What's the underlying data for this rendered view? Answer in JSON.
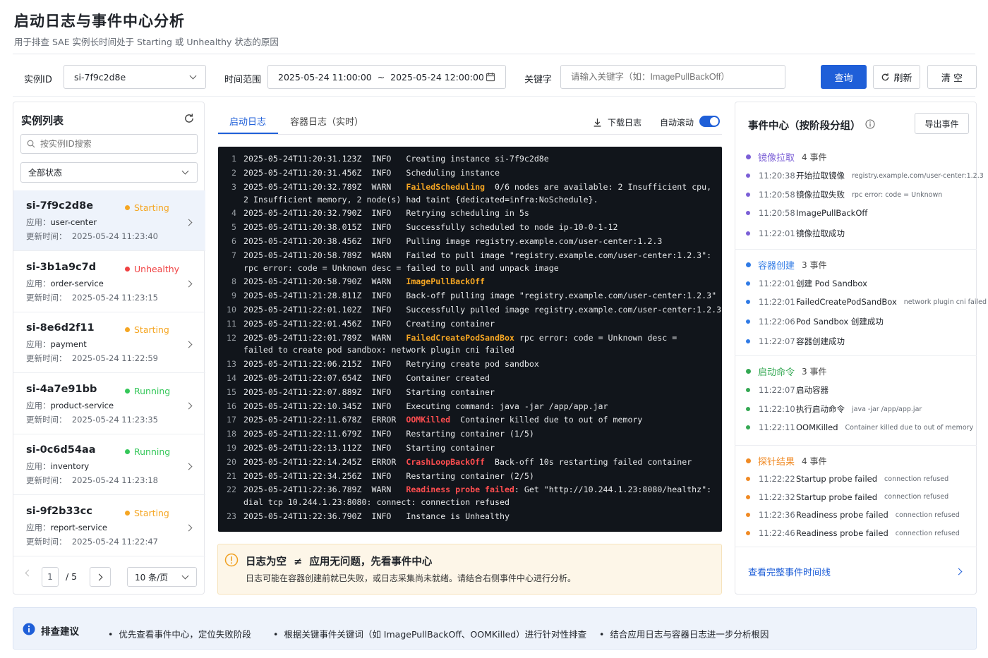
{
  "header": {
    "title": "启动日志与事件中心分析",
    "subtitle": "用于排查 SAE 实例长时间处于 Starting 或 Unhealthy 状态的原因"
  },
  "filters": {
    "instance_label": "实例ID",
    "instance_value": "si-7f9c2d8e",
    "time_label": "时间范围",
    "time_value": "2025-05-24 11:00:00  ~  2025-05-24 12:00:00",
    "keyword_label": "关键字",
    "keyword_placeholder": "请输入关键字（如：ImagePullBackOff）",
    "query": "查询",
    "refresh": "刷新",
    "clear": "清 空"
  },
  "list": {
    "title": "实例列表",
    "search_placeholder": "按实例ID搜索",
    "status_filter": "全部状态",
    "app_prefix": "应用：",
    "time_prefix": "更新时间：",
    "items": [
      {
        "id": "si-7f9c2d8e",
        "status": "Starting",
        "color": "#f5a623",
        "app": "user-center",
        "time": "2025-05-24 11:23:40"
      },
      {
        "id": "si-3b1a9c7d",
        "status": "Unhealthy",
        "color": "#f04142",
        "app": "order-service",
        "time": "2025-05-24 11:23:15"
      },
      {
        "id": "si-8e6d2f11",
        "status": "Starting",
        "color": "#f5a623",
        "app": "payment",
        "time": "2025-05-24 11:22:59"
      },
      {
        "id": "si-4a7e91bb",
        "status": "Running",
        "color": "#34c759",
        "app": "product-service",
        "time": "2025-05-24 11:23:35"
      },
      {
        "id": "si-0c6d54aa",
        "status": "Running",
        "color": "#34c759",
        "app": "inventory",
        "time": "2025-05-24 11:23:18"
      },
      {
        "id": "si-9f2b33cc",
        "status": "Starting",
        "color": "#f5a623",
        "app": "report-service",
        "time": "2025-05-24 11:22:47"
      }
    ],
    "pager": {
      "page": "1",
      "total": "/ 5",
      "size": "10 条/页"
    }
  },
  "logs": {
    "tab_active": "启动日志",
    "tab_other": "容器日志（实时）",
    "download": "下载日志",
    "autoscroll": "自动滚动",
    "lines": [
      {
        "n": "1",
        "a": "2025-05-24T11:20:31.123Z  INFO   Creating instance si-7f9c2d8e",
        "h": "",
        "c": ""
      },
      {
        "n": "2",
        "a": "2025-05-24T11:20:31.456Z  INFO   Scheduling instance",
        "h": "",
        "c": ""
      },
      {
        "n": "3",
        "a": "2025-05-24T11:20:32.789Z  WARN   ",
        "h": "FailedScheduling",
        "k": "warn",
        "c": "  0/6 nodes are available: 2 Insufficient cpu,\n2 Insufficient memory, 2 node(s) had taint {dedicated=infra:NoSchedule}."
      },
      {
        "n": "4",
        "a": "2025-05-24T11:20:32.790Z  INFO   Retrying scheduling in 5s",
        "h": "",
        "c": ""
      },
      {
        "n": "5",
        "a": "2025-05-24T11:20:38.015Z  INFO   Successfully scheduled to node ip-10-0-1-12",
        "h": "",
        "c": ""
      },
      {
        "n": "6",
        "a": "2025-05-24T11:20:38.456Z  INFO   Pulling image registry.example.com/user-center:1.2.3",
        "h": "",
        "c": ""
      },
      {
        "n": "7",
        "a": "2025-05-24T11:20:58.789Z  WARN   Failed to pull image \"registry.example.com/user-center:1.2.3\":\nrpc error: code = Unknown desc = failed to pull and unpack image",
        "h": "",
        "c": ""
      },
      {
        "n": "8",
        "a": "2025-05-24T11:20:58.790Z  WARN   ",
        "h": "ImagePullBackOff",
        "k": "warn",
        "c": ""
      },
      {
        "n": "9",
        "a": "2025-05-24T11:21:28.811Z  INFO   Back-off pulling image \"registry.example.com/user-center:1.2.3\"",
        "h": "",
        "c": ""
      },
      {
        "n": "10",
        "a": "2025-05-24T11:22:01.102Z  INFO   Successfully pulled image registry.example.com/user-center:1.2.3",
        "h": "",
        "c": ""
      },
      {
        "n": "11",
        "a": "2025-05-24T11:22:01.456Z  INFO   Creating container",
        "h": "",
        "c": ""
      },
      {
        "n": "12",
        "a": "2025-05-24T11:22:01.789Z  WARN   ",
        "h": "FailedCreatePodSandBox",
        "k": "warn",
        "c": " rpc error: code = Unknown desc =\nfailed to create pod sandbox: network plugin cni failed"
      },
      {
        "n": "13",
        "a": "2025-05-24T11:22:06.215Z  INFO   Retrying create pod sandbox",
        "h": "",
        "c": ""
      },
      {
        "n": "14",
        "a": "2025-05-24T11:22:07.654Z  INFO   Container created",
        "h": "",
        "c": ""
      },
      {
        "n": "15",
        "a": "2025-05-24T11:22:07.889Z  INFO   Starting container",
        "h": "",
        "c": ""
      },
      {
        "n": "16",
        "a": "2025-05-24T11:22:10.345Z  INFO   Executing command: java -jar /app/app.jar",
        "h": "",
        "c": ""
      },
      {
        "n": "17",
        "a": "2025-05-24T11:22:11.678Z  ERROR  ",
        "h": "OOMKilled",
        "k": "err",
        "c": "  Container killed due to out of memory"
      },
      {
        "n": "18",
        "a": "2025-05-24T11:22:11.679Z  INFO   Restarting container (1/5)",
        "h": "",
        "c": ""
      },
      {
        "n": "19",
        "a": "2025-05-24T11:22:13.112Z  INFO   Starting container",
        "h": "",
        "c": ""
      },
      {
        "n": "20",
        "a": "2025-05-24T11:22:14.245Z  ERROR  ",
        "h": "CrashLoopBackOff",
        "k": "err",
        "c": "  Back-off 10s restarting failed container"
      },
      {
        "n": "21",
        "a": "2025-05-24T11:22:34.256Z  INFO   Restarting container (2/5)",
        "h": "",
        "c": ""
      },
      {
        "n": "22",
        "a": "2025-05-24T11:22:36.789Z  WARN   ",
        "h": "Readiness probe failed",
        "k": "err",
        "c": ": Get \"http://10.244.1.23:8080/healthz\":\ndial tcp 10.244.1.23:8080: connect: connection refused"
      },
      {
        "n": "23",
        "a": "2025-05-24T11:22:36.790Z  INFO   Instance is Unhealthy",
        "h": "",
        "c": ""
      }
    ]
  },
  "notice": {
    "title": "日志为空  ≠  应用无问题，先看事件中心",
    "body": "日志可能在容器创建前就已失败，或日志采集尚未就绪。请结合右侧事件中心进行分析。"
  },
  "events": {
    "title": "事件中心（按阶段分组）",
    "export": "导出事件",
    "footer": "查看完整事件时间线",
    "groups": [
      {
        "name": "镜像拉取",
        "count": "4 事件",
        "color": "#7b5fd6",
        "items": [
          {
            "t": "11:20:38",
            "n": "开始拉取镜像",
            "x": "registry.example.com/user-center:1.2.3"
          },
          {
            "t": "11:20:58",
            "n": "镜像拉取失败",
            "x": "rpc error: code = Unknown"
          },
          {
            "t": "11:20:58",
            "n": "ImagePullBackOff",
            "x": ""
          },
          {
            "t": "11:22:01",
            "n": "镜像拉取成功",
            "x": ""
          }
        ]
      },
      {
        "name": "容器创建",
        "count": "3 事件",
        "color": "#2f7ae5",
        "items": [
          {
            "t": "11:22:01",
            "n": "创建 Pod Sandbox",
            "x": ""
          },
          {
            "t": "11:22:01",
            "n": "FailedCreatePodSandBox",
            "x": "network plugin cni failed"
          },
          {
            "t": "11:22:06",
            "n": "Pod Sandbox 创建成功",
            "x": ""
          },
          {
            "t": "11:22:07",
            "n": "容器创建成功",
            "x": ""
          }
        ]
      },
      {
        "name": "启动命令",
        "count": "3 事件",
        "color": "#34a853",
        "items": [
          {
            "t": "11:22:07",
            "n": "启动容器",
            "x": ""
          },
          {
            "t": "11:22:10",
            "n": "执行启动命令",
            "x": "java -jar /app/app.jar"
          },
          {
            "t": "11:22:11",
            "n": "OOMKilled",
            "x": "Container killed due to out of memory"
          }
        ]
      },
      {
        "name": "探针结果",
        "count": "4 事件",
        "color": "#f08a24",
        "items": [
          {
            "t": "11:22:22",
            "n": "Startup probe failed",
            "x": "connection refused"
          },
          {
            "t": "11:22:32",
            "n": "Startup probe failed",
            "x": "connection refused"
          },
          {
            "t": "11:22:36",
            "n": "Readiness probe failed",
            "x": "connection refused"
          },
          {
            "t": "11:22:46",
            "n": "Readiness probe failed",
            "x": "connection refused"
          }
        ]
      }
    ]
  },
  "advice": {
    "title": "排查建议",
    "items": [
      "优先查看事件中心，定位失败阶段",
      "根据关键事件关键词（如 ImagePullBackOff、OOMKilled）进行针对性排查",
      "结合应用日志与容器日志进一步分析根因"
    ]
  }
}
